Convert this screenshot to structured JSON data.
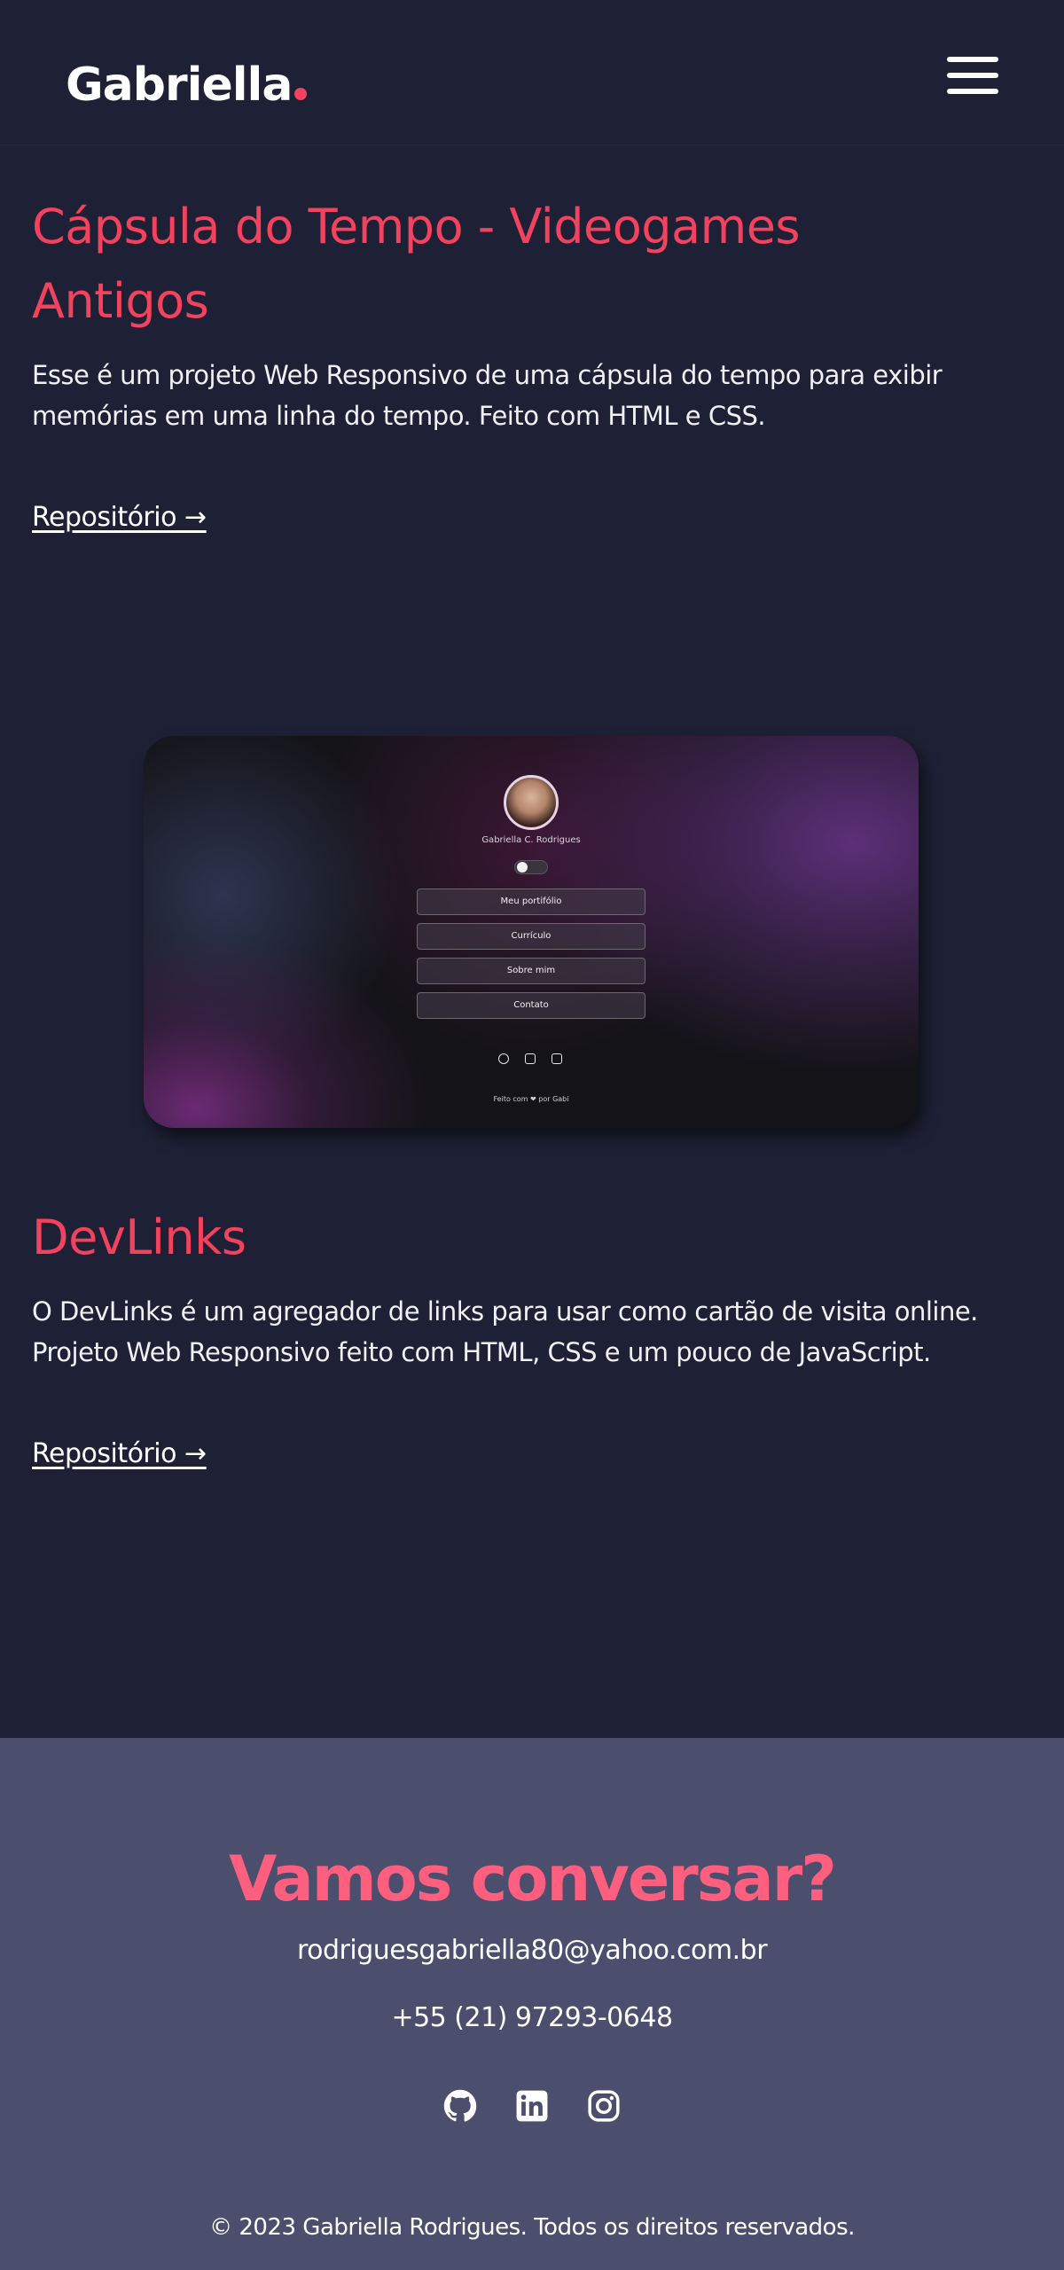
{
  "header": {
    "logo": "Gabriella",
    "menu_icon": "hamburger-menu-icon"
  },
  "projects": [
    {
      "title_line1": "Cápsula do Tempo - Videogames",
      "title_line2": "Antigos",
      "desc_line1": "Esse é um projeto Web Responsivo de uma cápsula do tempo para exibir",
      "desc_line2": "memórias em uma linha do tempo. Feito com HTML e CSS.",
      "link": "Repositório →"
    },
    {
      "title": "DevLinks",
      "desc_line1": "O DevLinks é um agregador de links para usar como cartão de visita online.",
      "desc_line2": "Projeto Web Responsivo feito com HTML, CSS e um pouco de JavaScript.",
      "link": "Repositório →",
      "preview": {
        "name": "Gabriella C. Rodrigues",
        "buttons": [
          "Meu portifólio",
          "Currículo",
          "Sobre mim",
          "Contato"
        ],
        "footer": "Feito com ❤ por Gabi"
      }
    }
  ],
  "contact": {
    "title": "Vamos conversar?",
    "email": "rodriguesgabriella80@yahoo.com.br",
    "phone": "+55 (21) 97293-0648",
    "socials": [
      "github-icon",
      "linkedin-icon",
      "instagram-icon"
    ],
    "copyright": "© 2023 Gabriella Rodrigues. Todos os direitos reservados."
  },
  "colors": {
    "background": "#1e2035",
    "accent": "#f2425e",
    "contact_bg": "#4b4e6d",
    "contact_title": "#ff5f7e"
  }
}
